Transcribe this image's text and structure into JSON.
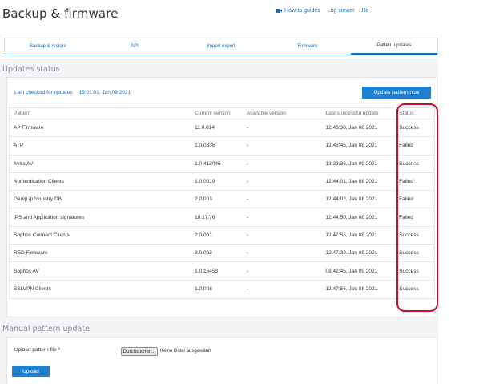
{
  "page": {
    "title": "Backup & firmware"
  },
  "toplinks": {
    "howto": "How-to guides",
    "logviewer": "Log viewer",
    "help": "Help"
  },
  "tabs": [
    {
      "label": "Backup & restore"
    },
    {
      "label": "API"
    },
    {
      "label": "Import export"
    },
    {
      "label": "Firmware"
    },
    {
      "label": "Pattern updates"
    }
  ],
  "updates": {
    "heading": "Updates status",
    "last_checked_label": "Last checked for updates",
    "last_checked_value": "15:01:01, Jan 09 2021",
    "button": "Update pattern now",
    "columns": [
      "Pattern",
      "Current version",
      "Available version",
      "Last successful update",
      "Status"
    ],
    "rows": [
      [
        "AP Firmware",
        "11.0.014",
        "-",
        "12:43:30, Jan 08 2021",
        "Success"
      ],
      [
        "ATP",
        "1.0.0336",
        "-",
        "12:43:45, Jan 08 2021",
        "Failed"
      ],
      [
        "Avira AV",
        "1.0.413046",
        "-",
        "13:32:36, Jan 09 2021",
        "Success"
      ],
      [
        "Authentication Clients",
        "1.0.0019",
        "-",
        "12:44:01, Jan 08 2021",
        "Failed"
      ],
      [
        "Geoip ip2country DB",
        "2.0.003",
        "-",
        "12:44:02, Jan 08 2021",
        "Failed"
      ],
      [
        "IPS and Application signatures",
        "18.17.76",
        "-",
        "12:44:50, Jan 08 2021",
        "Failed"
      ],
      [
        "Sophos Connect Clients",
        "2.0.001",
        "-",
        "12:47:55, Jan 08 2021",
        "Success"
      ],
      [
        "RED Firmware",
        "3.0.003",
        "-",
        "12:47:32, Jan 08 2021",
        "Success"
      ],
      [
        "Sophos AV",
        "1.0.16453",
        "-",
        "08:42:45, Jan 09 2021",
        "Success"
      ],
      [
        "SSLVPN Clients",
        "1.0.008",
        "-",
        "12:47:56, Jan 08 2021",
        "Success"
      ]
    ]
  },
  "manual": {
    "heading": "Manual pattern update",
    "file_label": "Upload pattern file *",
    "browse": "Durchsuchen...",
    "no_file": "Keine Datei ausgewählt.",
    "upload_button": "Upload"
  },
  "colors": {
    "accent": "#1f7fd1",
    "highlight": "#c8102e"
  }
}
